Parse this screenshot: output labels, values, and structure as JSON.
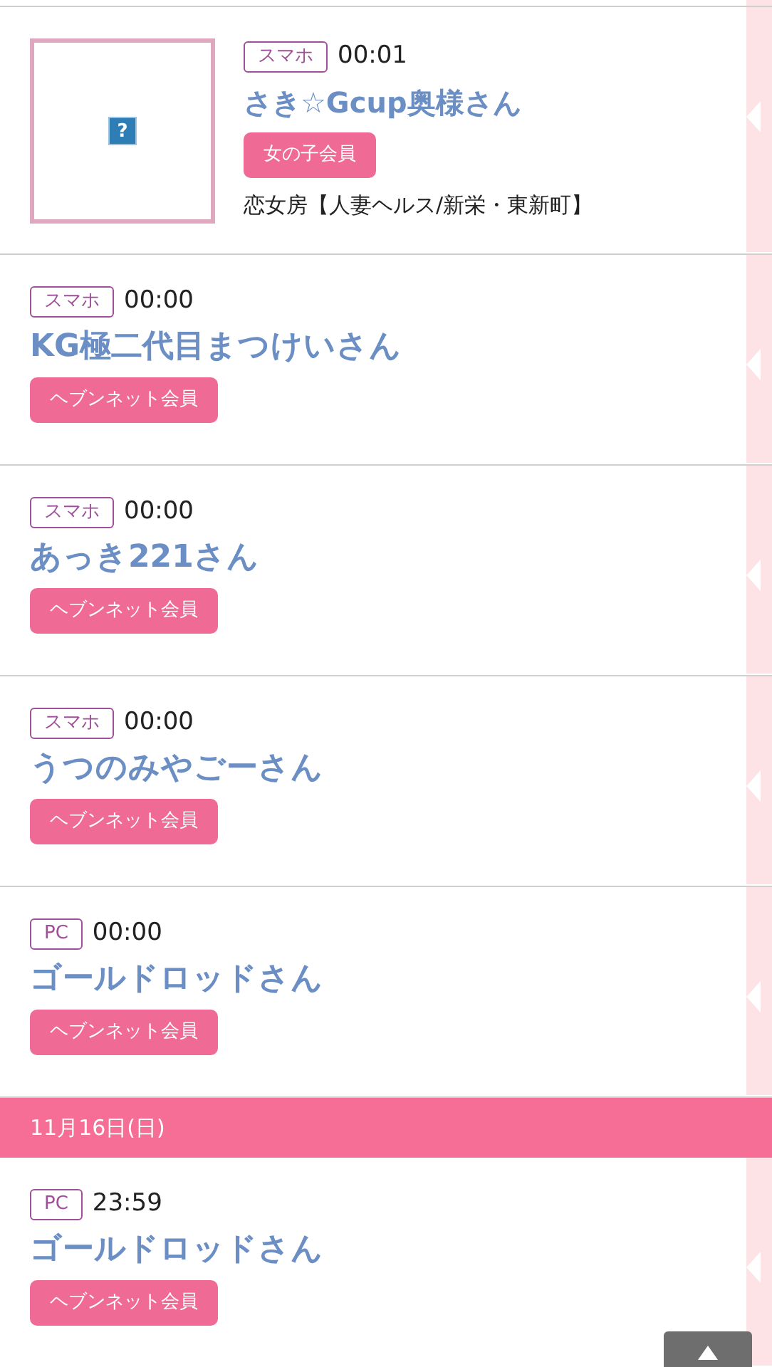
{
  "entries": [
    {
      "kind": "featured",
      "thumb_glyph": "?",
      "device": "スマホ",
      "time": "00:01",
      "name": "さき☆Gcup奥様さん",
      "member": "女の子会員",
      "shop": "恋女房【人妻ヘルス/新栄・東新町】"
    },
    {
      "kind": "plain",
      "device": "スマホ",
      "time": "00:00",
      "name": "KG極二代目まつけいさん",
      "member": "ヘブンネット会員"
    },
    {
      "kind": "plain",
      "device": "スマホ",
      "time": "00:00",
      "name": "あっき221さん",
      "member": "ヘブンネット会員"
    },
    {
      "kind": "plain",
      "device": "スマホ",
      "time": "00:00",
      "name": "うつのみやごーさん",
      "member": "ヘブンネット会員"
    },
    {
      "kind": "plain",
      "device": "PC",
      "time": "00:00",
      "name": "ゴールドロッドさん",
      "member": "ヘブンネット会員"
    },
    {
      "kind": "date",
      "label": "11月16日(日)"
    },
    {
      "kind": "plain",
      "device": "PC",
      "time": "23:59",
      "name": "ゴールドロッドさん",
      "member": "ヘブンネット会員"
    }
  ]
}
